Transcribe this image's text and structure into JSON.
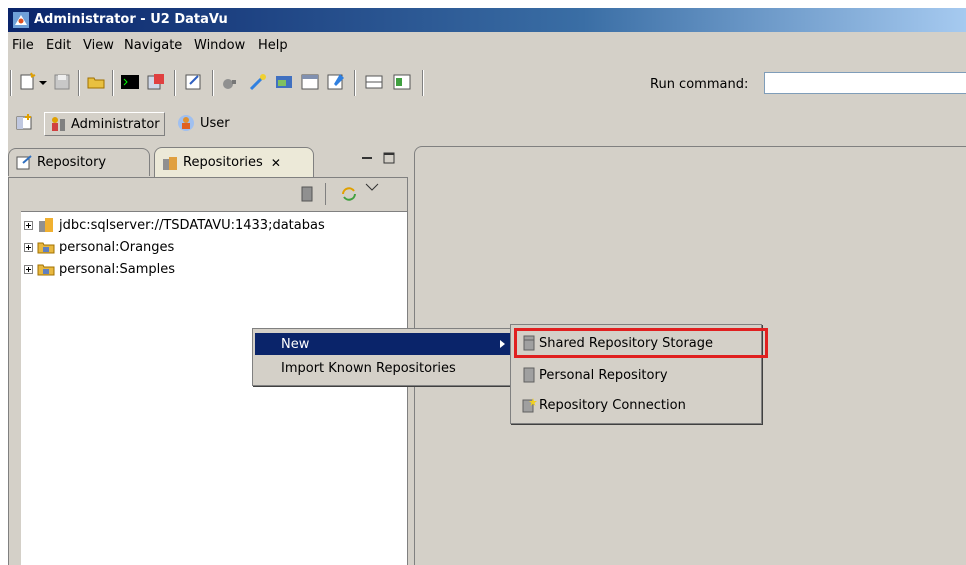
{
  "window": {
    "title": "Administrator - U2 DataVu"
  },
  "menubar": [
    "File",
    "Edit",
    "View",
    "Navigate",
    "Window",
    "Help"
  ],
  "toolbar": {
    "run_command_label": "Run command:",
    "run_command_value": ""
  },
  "perspectives": {
    "administrator": "Administrator",
    "user": "User"
  },
  "view": {
    "tabs": [
      {
        "label": "Repository"
      },
      {
        "label": "Repositories",
        "close": "✕"
      }
    ],
    "tree": [
      {
        "label": "jdbc:sqlserver://TSDATAVU:1433;databas"
      },
      {
        "label": "personal:Oranges"
      },
      {
        "label": "personal:Samples"
      }
    ]
  },
  "context_menu": {
    "items": [
      {
        "label": "New"
      },
      {
        "label": "Import Known Repositories"
      }
    ]
  },
  "submenu": {
    "items": [
      {
        "label": "Shared Repository Storage"
      },
      {
        "label": "Personal Repository"
      },
      {
        "label": "Repository Connection"
      }
    ]
  }
}
